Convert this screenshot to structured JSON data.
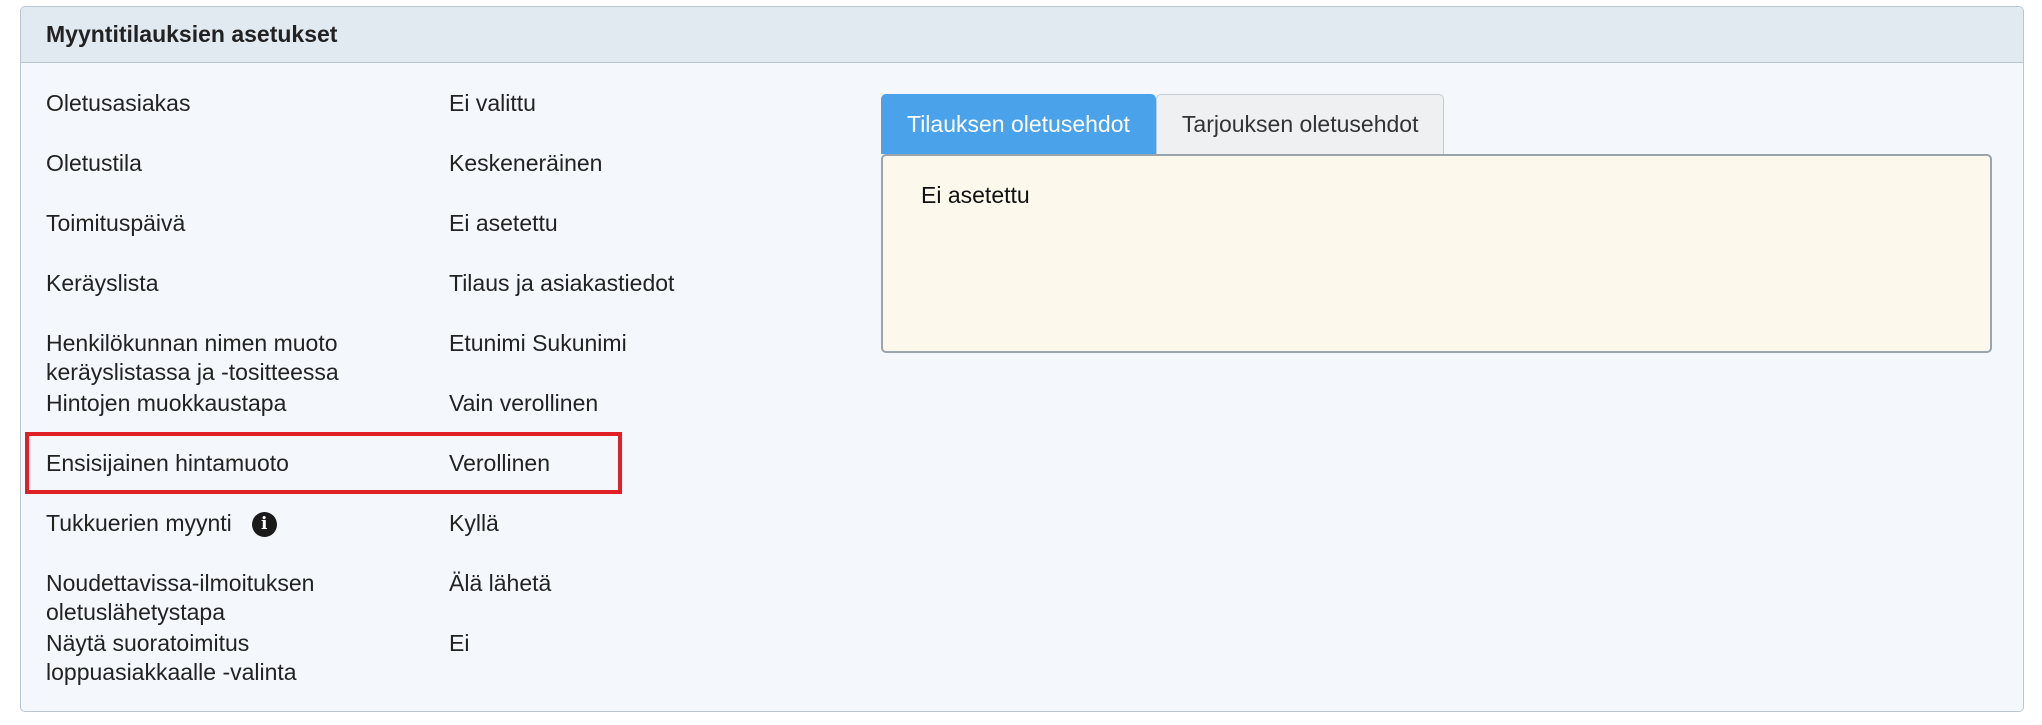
{
  "panel": {
    "title": "Myyntitilauksien asetukset"
  },
  "settings": [
    {
      "label": "Oletusasiakas",
      "value": "Ei valittu"
    },
    {
      "label": "Oletustila",
      "value": "Keskeneräinen"
    },
    {
      "label": "Toimituspäivä",
      "value": "Ei asetettu"
    },
    {
      "label": "Keräyslista",
      "value": "Tilaus ja asiakastiedot"
    },
    {
      "label_line1": "Henkilökunnan nimen muoto",
      "label_line2": "keräyslistassa ja -tositteessa",
      "value": "Etunimi Sukunimi"
    },
    {
      "label": "Hintojen muokkaustapa",
      "value": "Vain verollinen"
    },
    {
      "label": "Ensisijainen hintamuoto",
      "value": "Verollinen"
    },
    {
      "label": "Tukkuerien myynti",
      "value": "Kyllä",
      "icon": "info-icon",
      "icon_glyph": "i"
    },
    {
      "label_line1": "Noudettavissa-ilmoituksen",
      "label_line2": "oletuslähetystapa",
      "value": "Älä lähetä"
    },
    {
      "label_line1": "Näytä suoratoimitus",
      "label_line2": "loppuasiakkaalle -valinta",
      "value": "Ei"
    }
  ],
  "tabs": [
    {
      "label": "Tilauksen oletusehdot",
      "active": true
    },
    {
      "label": "Tarjouksen oletusehdot",
      "active": false
    }
  ],
  "terms": {
    "content": "Ei asetettu"
  },
  "colors": {
    "tab_active": "#4aa3ea",
    "highlight": "#e11f26",
    "terms_background": "#fcf9ec"
  }
}
